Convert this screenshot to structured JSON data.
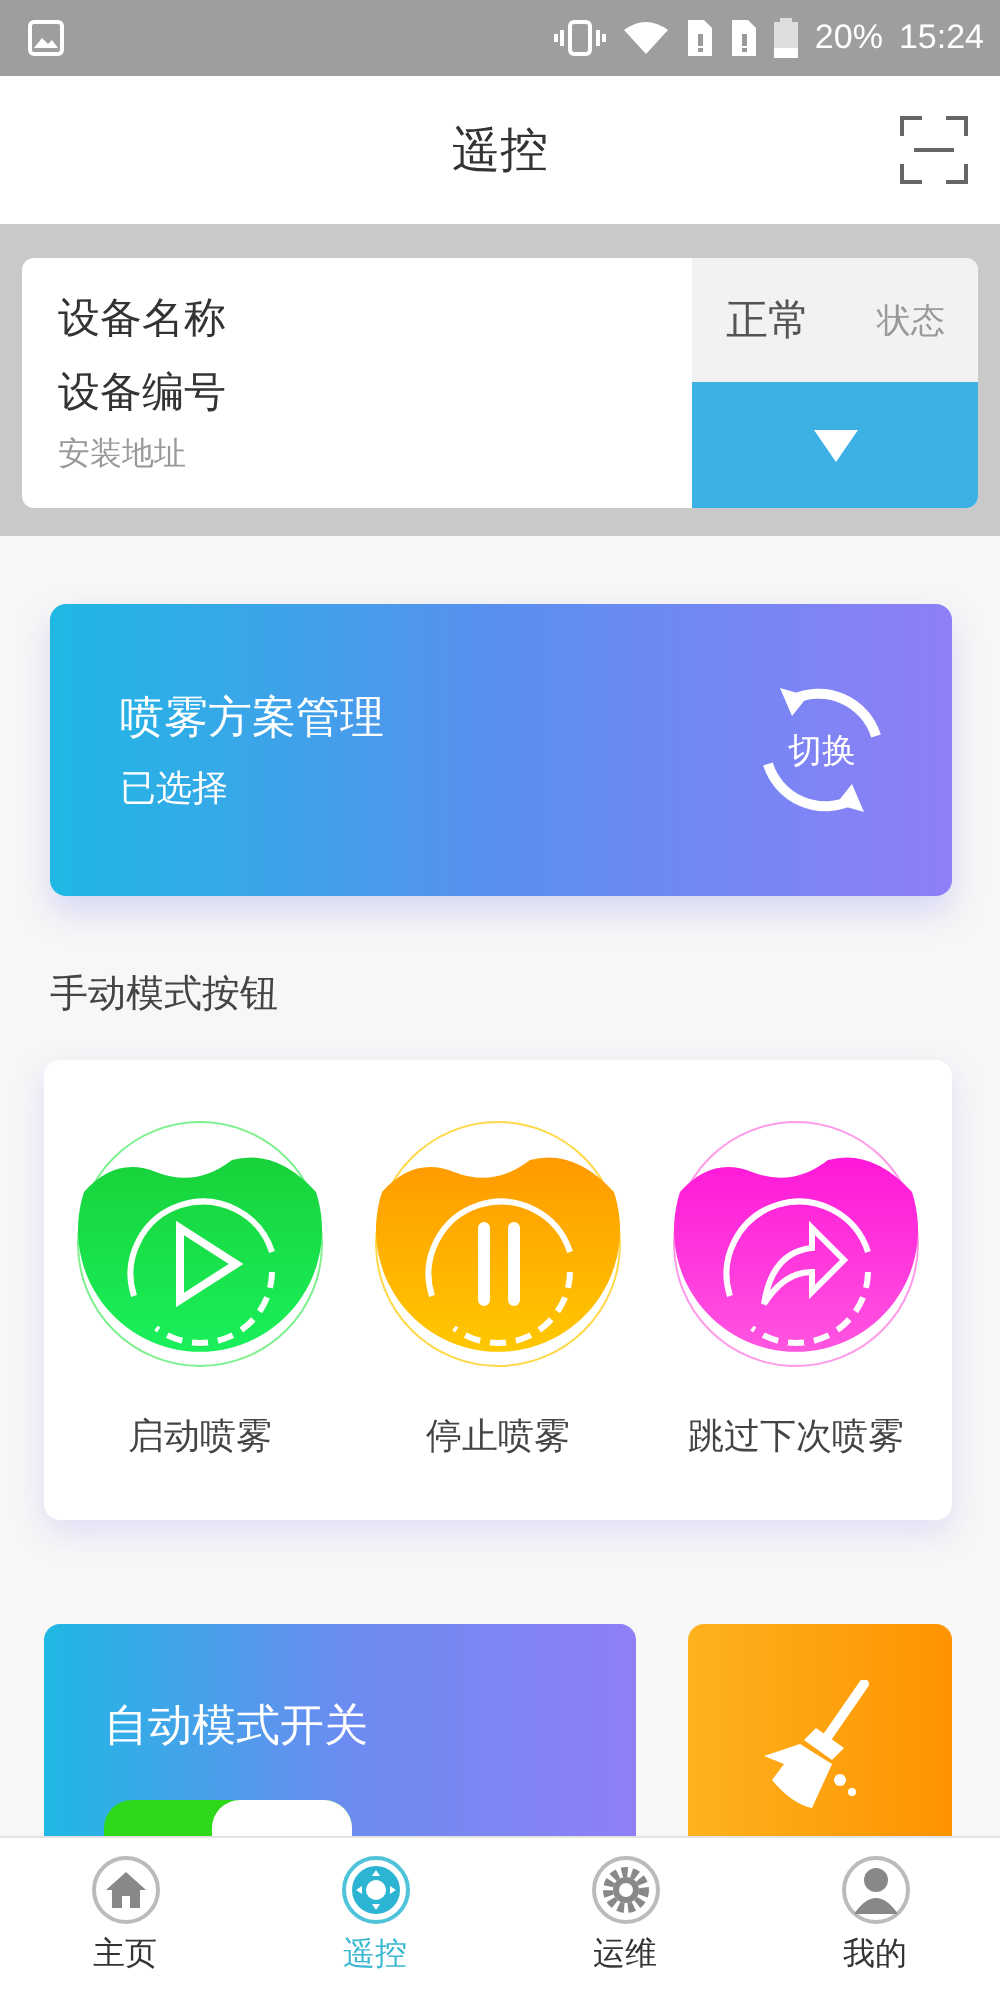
{
  "status_bar": {
    "battery": "20%",
    "time": "15:24"
  },
  "header": {
    "title": "遥控"
  },
  "device": {
    "name": "设备名称",
    "number": "设备编号",
    "address": "安装地址",
    "status_value": "正常",
    "status_label": "状态"
  },
  "plan": {
    "title": "喷雾方案管理",
    "subtitle": "已选择",
    "switch_label": "切换"
  },
  "manual_section": {
    "title": "手动模式按钮"
  },
  "manual_buttons": [
    {
      "kind": "play",
      "label": "启动喷雾"
    },
    {
      "kind": "pause",
      "label": "停止喷雾"
    },
    {
      "kind": "skip",
      "label": "跳过下次喷雾"
    }
  ],
  "auto_mode": {
    "label": "自动模式开关",
    "on": true
  },
  "tabs": [
    {
      "kind": "home",
      "label": "主页",
      "selected": false
    },
    {
      "kind": "remote",
      "label": "遥控",
      "selected": true
    },
    {
      "kind": "gear",
      "label": "运维",
      "selected": false
    },
    {
      "kind": "person",
      "label": "我的",
      "selected": false
    }
  ]
}
